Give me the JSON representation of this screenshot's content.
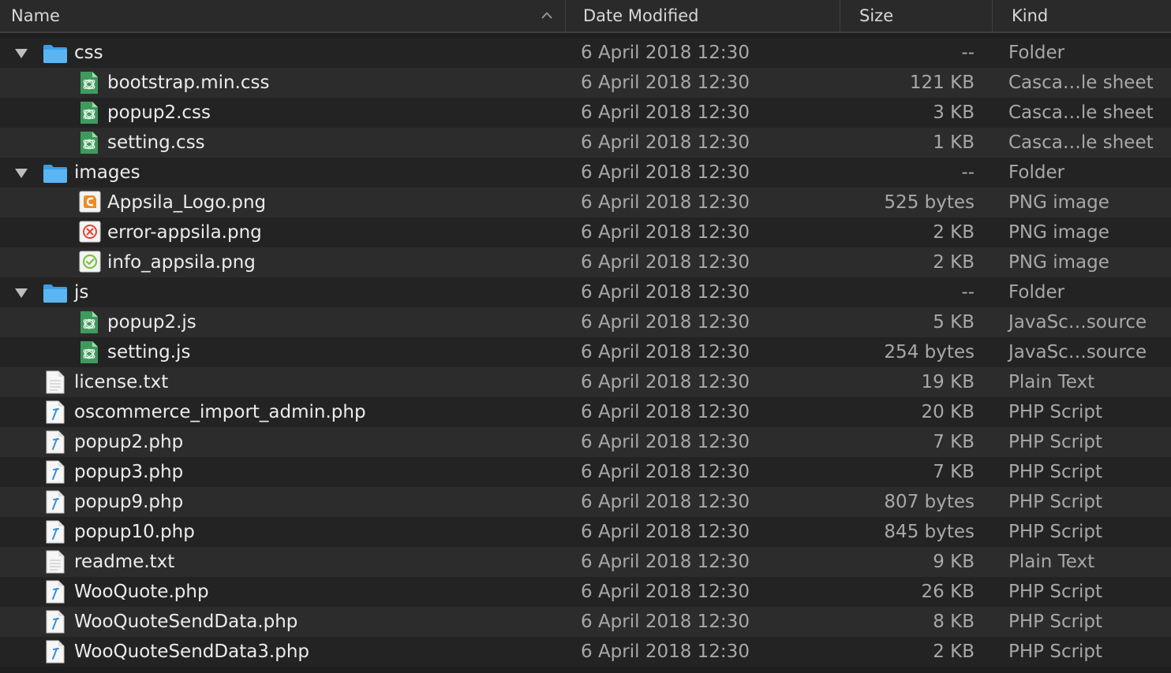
{
  "header": {
    "name": "Name",
    "date_modified": "Date Modified",
    "size": "Size",
    "kind": "Kind",
    "sort_icon": "chevron-up-icon"
  },
  "rows": [
    {
      "name": "css",
      "date": "6 April 2018 12:30",
      "size": "--",
      "kind": "Folder",
      "icon": "folder",
      "depth": 0,
      "expanded": true
    },
    {
      "name": "bootstrap.min.css",
      "date": "6 April 2018 12:30",
      "size": "121 KB",
      "kind": "Casca…le sheet",
      "icon": "css",
      "depth": 1
    },
    {
      "name": "popup2.css",
      "date": "6 April 2018 12:30",
      "size": "3 KB",
      "kind": "Casca…le sheet",
      "icon": "css",
      "depth": 1
    },
    {
      "name": "setting.css",
      "date": "6 April 2018 12:30",
      "size": "1 KB",
      "kind": "Casca…le sheet",
      "icon": "css",
      "depth": 1
    },
    {
      "name": "images",
      "date": "6 April 2018 12:30",
      "size": "--",
      "kind": "Folder",
      "icon": "folder",
      "depth": 0,
      "expanded": true
    },
    {
      "name": "Appsila_Logo.png",
      "date": "6 April 2018 12:30",
      "size": "525 bytes",
      "kind": "PNG image",
      "icon": "png-logo",
      "depth": 1
    },
    {
      "name": "error-appsila.png",
      "date": "6 April 2018 12:30",
      "size": "2 KB",
      "kind": "PNG image",
      "icon": "png-error",
      "depth": 1
    },
    {
      "name": "info_appsila.png",
      "date": "6 April 2018 12:30",
      "size": "2 KB",
      "kind": "PNG image",
      "icon": "png-info",
      "depth": 1
    },
    {
      "name": "js",
      "date": "6 April 2018 12:30",
      "size": "--",
      "kind": "Folder",
      "icon": "folder",
      "depth": 0,
      "expanded": true
    },
    {
      "name": "popup2.js",
      "date": "6 April 2018 12:30",
      "size": "5 KB",
      "kind": "JavaSc…source",
      "icon": "js",
      "depth": 1
    },
    {
      "name": "setting.js",
      "date": "6 April 2018 12:30",
      "size": "254 bytes",
      "kind": "JavaSc…source",
      "icon": "js",
      "depth": 1
    },
    {
      "name": "license.txt",
      "date": "6 April 2018 12:30",
      "size": "19 KB",
      "kind": "Plain Text",
      "icon": "txt",
      "depth": 0
    },
    {
      "name": "oscommerce_import_admin.php",
      "date": "6 April 2018 12:30",
      "size": "20 KB",
      "kind": "PHP Script",
      "icon": "php",
      "depth": 0
    },
    {
      "name": "popup2.php",
      "date": "6 April 2018 12:30",
      "size": "7 KB",
      "kind": "PHP Script",
      "icon": "php",
      "depth": 0
    },
    {
      "name": "popup3.php",
      "date": "6 April 2018 12:30",
      "size": "7 KB",
      "kind": "PHP Script",
      "icon": "php",
      "depth": 0
    },
    {
      "name": "popup9.php",
      "date": "6 April 2018 12:30",
      "size": "807 bytes",
      "kind": "PHP Script",
      "icon": "php",
      "depth": 0
    },
    {
      "name": "popup10.php",
      "date": "6 April 2018 12:30",
      "size": "845 bytes",
      "kind": "PHP Script",
      "icon": "php",
      "depth": 0
    },
    {
      "name": "readme.txt",
      "date": "6 April 2018 12:30",
      "size": "9 KB",
      "kind": "Plain Text",
      "icon": "txt",
      "depth": 0
    },
    {
      "name": "WooQuote.php",
      "date": "6 April 2018 12:30",
      "size": "26 KB",
      "kind": "PHP Script",
      "icon": "php",
      "depth": 0
    },
    {
      "name": "WooQuoteSendData.php",
      "date": "6 April 2018 12:30",
      "size": "8 KB",
      "kind": "PHP Script",
      "icon": "php",
      "depth": 0
    },
    {
      "name": "WooQuoteSendData3.php",
      "date": "6 April 2018 12:30",
      "size": "2 KB",
      "kind": "PHP Script",
      "icon": "php",
      "depth": 0
    }
  ]
}
